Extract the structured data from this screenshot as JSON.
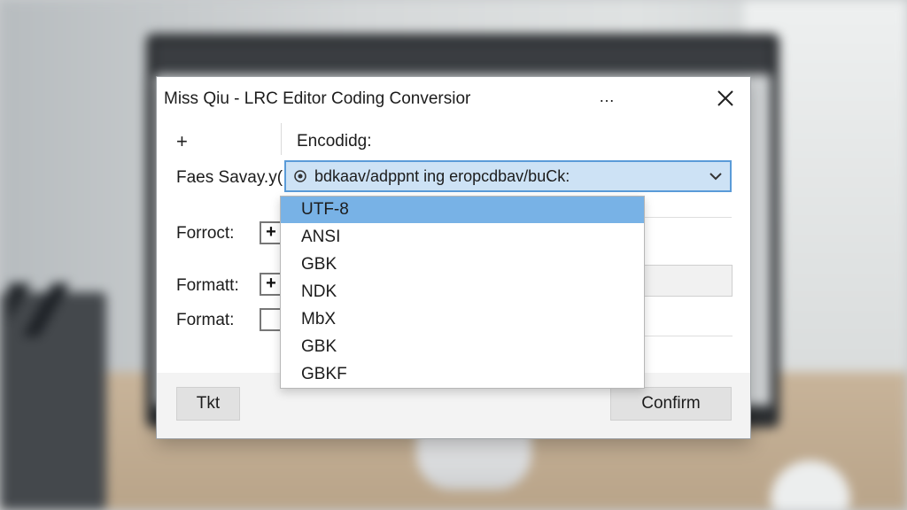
{
  "dialog": {
    "title": "Miss Qiu - LRC Editor Coding Conversior",
    "more_label": "…",
    "add_label": "+",
    "encoding_label": "Encodidg:",
    "files_label": "Faes Savay.y(",
    "combo_value": "bdkaav/adppnt ing eropcdbav/buCk:",
    "format_rows": [
      {
        "label": "Forroct:",
        "box": "+"
      },
      {
        "label": "Formatt:",
        "box": "+"
      },
      {
        "label": "Format:",
        "box": ""
      }
    ],
    "buttons": {
      "left_label": "Tkt",
      "confirm_label": "Confirm"
    }
  },
  "dropdown": {
    "options": [
      "UTF-8",
      "ANSI",
      "GBK",
      "NDK",
      "MbX",
      "GBK",
      "GBKF"
    ],
    "selected_index": 0
  },
  "colors": {
    "accent": "#5a9bd8",
    "selected_option": "#78b2e6",
    "combo_fill": "#cde2f5"
  }
}
